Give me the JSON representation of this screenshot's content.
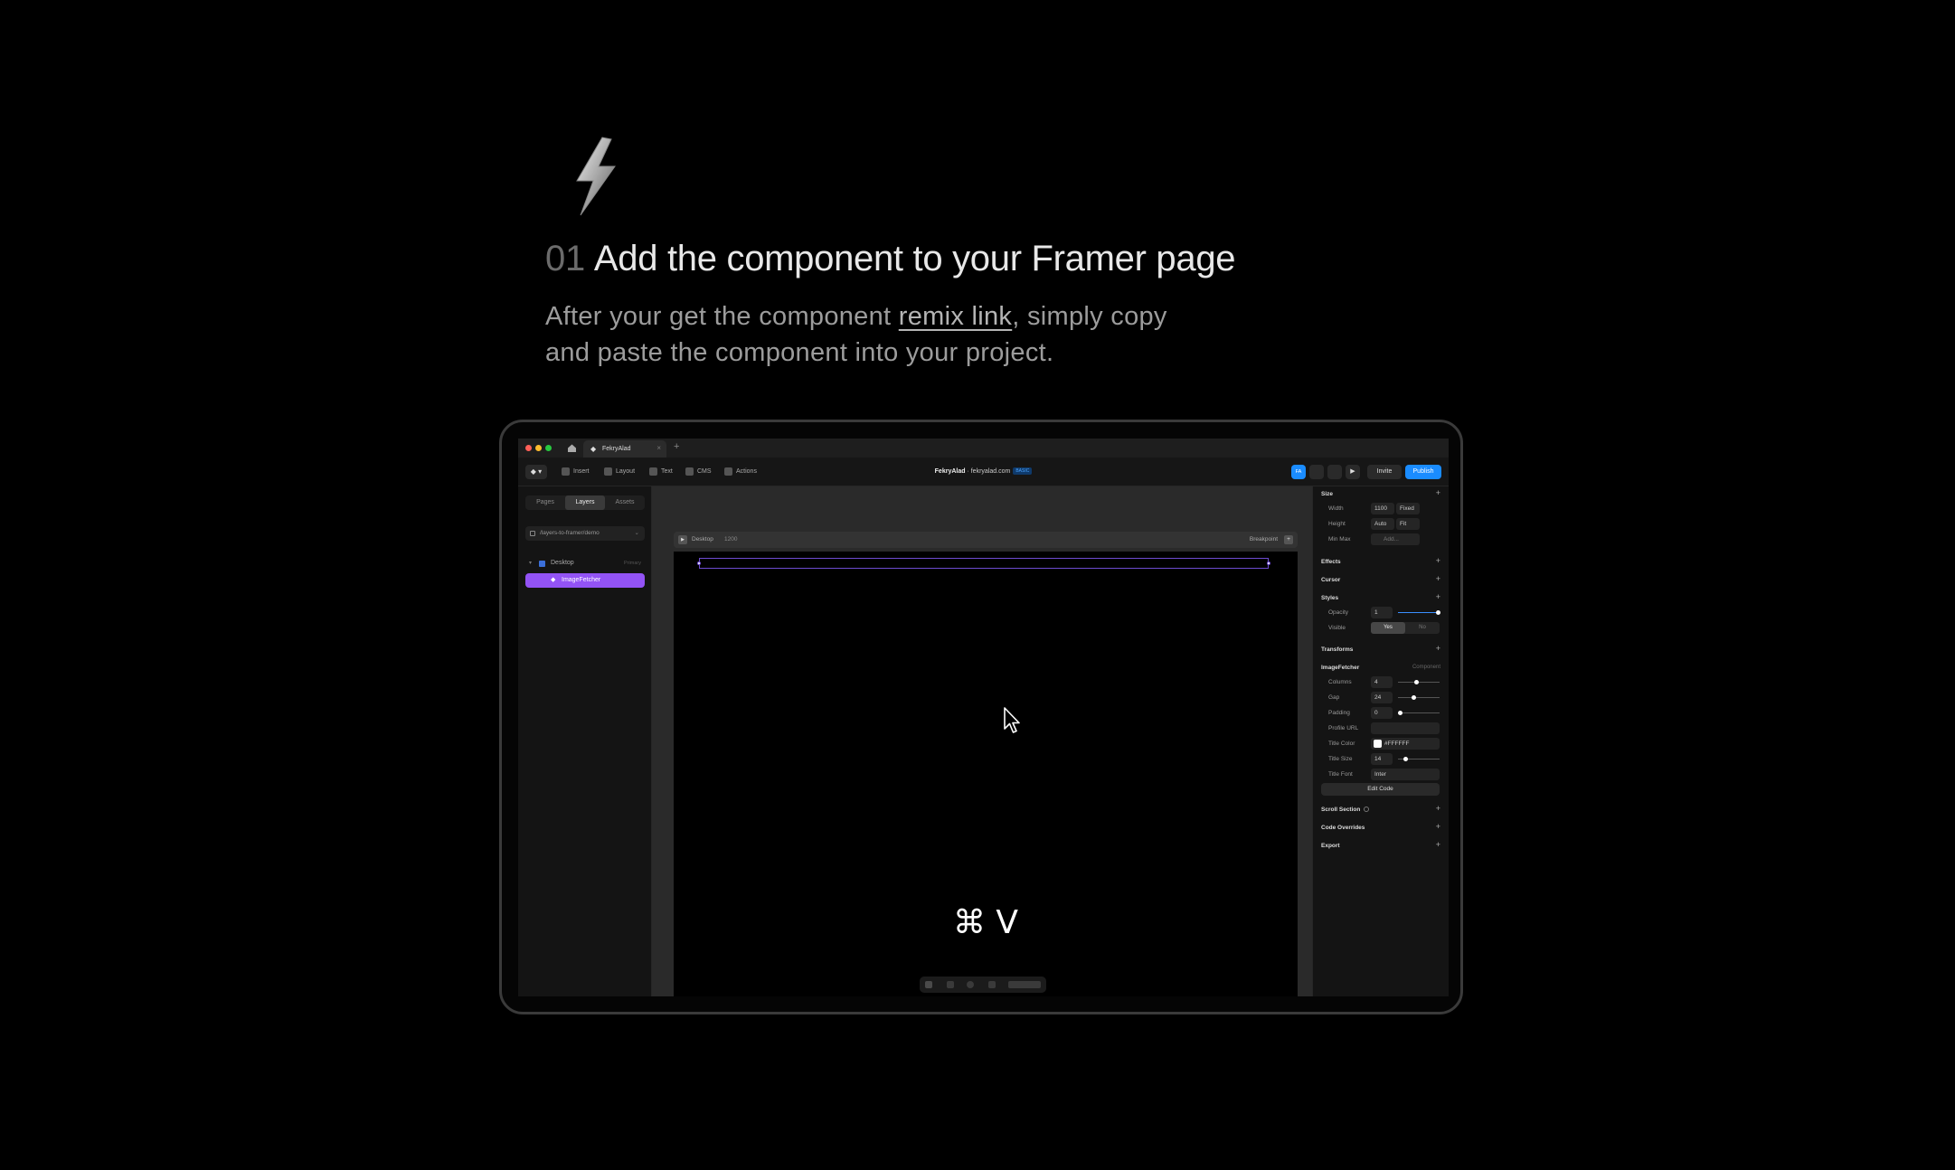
{
  "step": {
    "number": "01",
    "title": "Add the component to your Framer page",
    "desc_before": "After your get the component ",
    "desc_link": "remix link",
    "desc_after": ", simply copy and paste the component into your project."
  },
  "colors": {
    "accent": "#9353f5",
    "brand_blue": "#1a8cff",
    "selection": "#6d4bd0"
  },
  "app": {
    "tab_label": "FekryAlad",
    "toolbar": {
      "tools": [
        "Insert",
        "Layout",
        "Text",
        "CMS",
        "Actions"
      ],
      "project_name": "FekryAlad",
      "project_domain": " · fekryalad.com",
      "project_badge": "BASIC",
      "avatar": "FA",
      "invite_label": "Invite",
      "publish_label": "Publish"
    },
    "left_panel": {
      "tabs": [
        "Pages",
        "Layers",
        "Assets"
      ],
      "active_tab": "Layers",
      "page_selector": "/layers-to-framer/demo",
      "layers": [
        {
          "name": "Desktop",
          "tag": "Primary",
          "selected": false
        },
        {
          "name": "ImageFetcher",
          "selected": true
        }
      ]
    },
    "canvas": {
      "frame_name": "Desktop",
      "frame_width": "1200",
      "breakpoint_label": "Breakpoint",
      "shortcut": "⌘ V"
    },
    "right_panel": {
      "size": {
        "title": "Size",
        "width_label": "Width",
        "width_value": "1100",
        "width_mode": "Fixed",
        "height_label": "Height",
        "height_value": "Auto",
        "height_mode": "Fit",
        "minmax_label": "Min Max",
        "minmax_value": "Add..."
      },
      "effects_title": "Effects",
      "cursor_title": "Cursor",
      "styles": {
        "title": "Styles",
        "opacity_label": "Opacity",
        "opacity_value": "1",
        "visible_label": "Visible",
        "yes": "Yes",
        "no": "No",
        "visible": "Yes"
      },
      "transforms_title": "Transforms",
      "component": {
        "title": "ImageFetcher",
        "tag": "Component",
        "columns_label": "Columns",
        "columns_value": "4",
        "gap_label": "Gap",
        "gap_value": "24",
        "padding_label": "Padding",
        "padding_value": "0",
        "profile_label": "Profile URL",
        "profile_value": "",
        "title_color_label": "Title Color",
        "title_color_value": "#FFFFFF",
        "title_size_label": "Title Size",
        "title_size_value": "14",
        "title_font_label": "Title Font",
        "title_font_value": "Inter",
        "edit_code_label": "Edit Code"
      },
      "scroll_section_title": "Scroll Section",
      "code_overrides_title": "Code Overrides",
      "export_title": "Export"
    }
  }
}
